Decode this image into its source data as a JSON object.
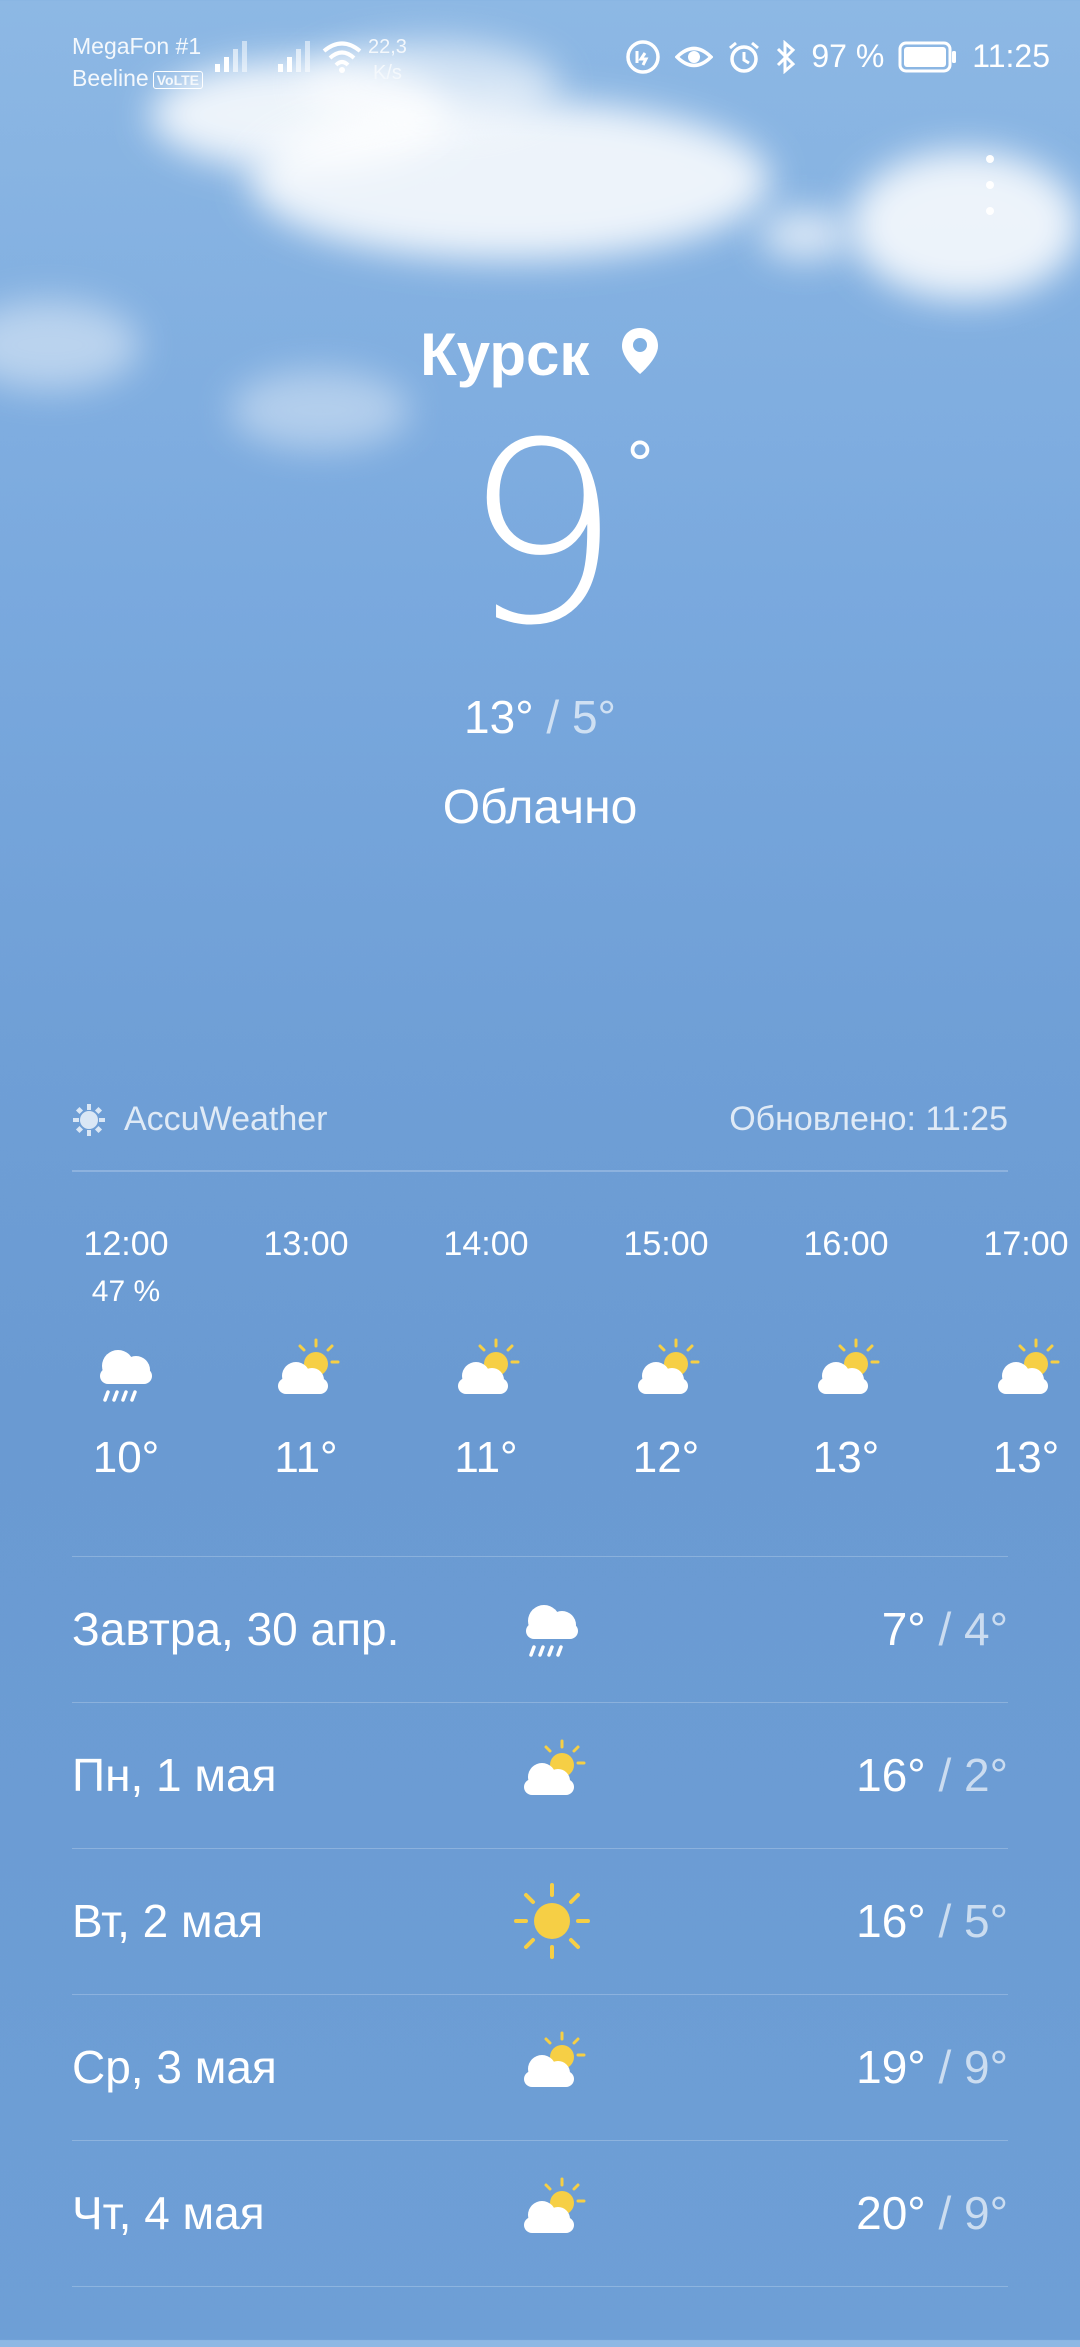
{
  "status_bar": {
    "carrier1": "MegaFon #1",
    "carrier2": "Beeline",
    "volte": "VoLTE",
    "net_speed_value": "22,3",
    "net_speed_unit": "K/s",
    "battery": "97 %",
    "time": "11:25"
  },
  "location": {
    "city": "Курск"
  },
  "current": {
    "temp": "9",
    "degree": "°",
    "high": "13°",
    "separator": "/",
    "low": "5°",
    "condition": "Облачно"
  },
  "source": {
    "provider": "AccuWeather",
    "updated": "Обновлено: 11:25"
  },
  "hourly": [
    {
      "time": "12:00",
      "precip": "47 %",
      "icon": "rain-cloud-icon",
      "temp": "10°"
    },
    {
      "time": "13:00",
      "precip": "",
      "icon": "partly-sunny-icon",
      "temp": "11°"
    },
    {
      "time": "14:00",
      "precip": "",
      "icon": "partly-sunny-icon",
      "temp": "11°"
    },
    {
      "time": "15:00",
      "precip": "",
      "icon": "partly-sunny-icon",
      "temp": "12°"
    },
    {
      "time": "16:00",
      "precip": "",
      "icon": "partly-sunny-icon",
      "temp": "13°"
    },
    {
      "time": "17:00",
      "precip": "",
      "icon": "partly-sunny-icon",
      "temp": "13°"
    }
  ],
  "daily": [
    {
      "day": "Завтра, 30 апр.",
      "icon": "rain-cloud-icon",
      "high": "7°",
      "low": "4°"
    },
    {
      "day": "Пн, 1 мая",
      "icon": "partly-sunny-icon",
      "high": "16°",
      "low": "2°"
    },
    {
      "day": "Вт, 2 мая",
      "icon": "sun-icon",
      "high": "16°",
      "low": "5°"
    },
    {
      "day": "Ср, 3 мая",
      "icon": "partly-sunny-icon",
      "high": "19°",
      "low": "9°"
    },
    {
      "day": "Чт, 4 мая",
      "icon": "partly-sunny-icon",
      "high": "20°",
      "low": "9°"
    }
  ],
  "colors": {
    "sun": "#f6cf45",
    "cloud": "#ffffff"
  }
}
